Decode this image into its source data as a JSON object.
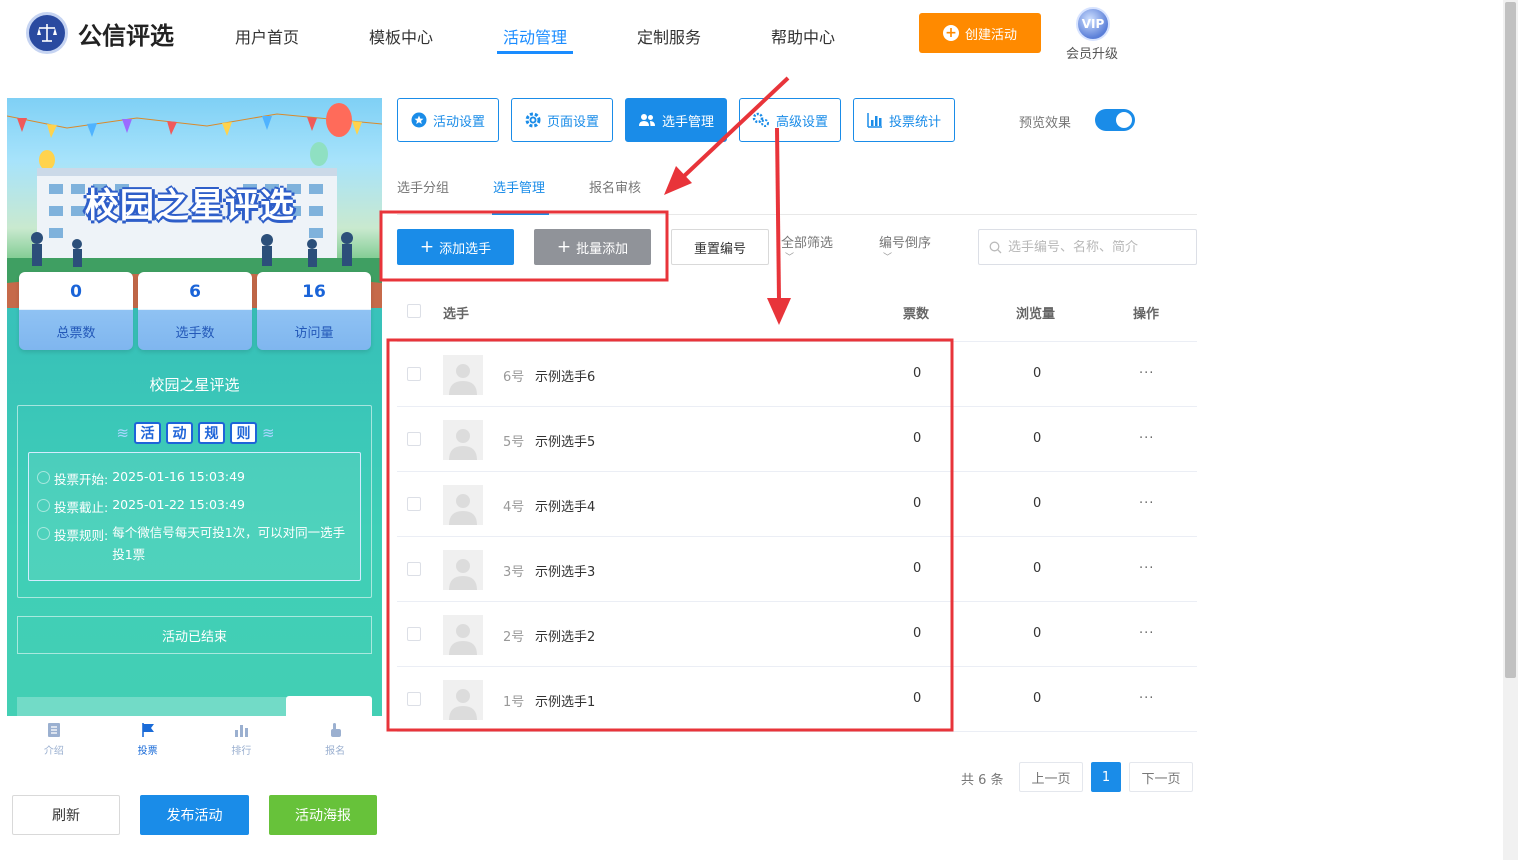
{
  "header": {
    "logo_text": "公信评选",
    "nav": [
      "用户首页",
      "模板中心",
      "活动管理",
      "定制服务",
      "帮助中心"
    ],
    "active_nav": "活动管理",
    "create_label": "创建活动",
    "vip_badge": "VIP",
    "vip_label": "会员升级"
  },
  "preview": {
    "banner_title": "校园之星评选",
    "stats": [
      {
        "value": "0",
        "label": "总票数"
      },
      {
        "value": "6",
        "label": "选手数"
      },
      {
        "value": "16",
        "label": "访问量"
      }
    ],
    "title": "校园之星评选",
    "rules_chars": [
      "活",
      "动",
      "规",
      "则"
    ],
    "rules": [
      {
        "label": "投票开始:",
        "text": "2025-01-16 15:03:49"
      },
      {
        "label": "投票截止:",
        "text": "2025-01-22 15:03:49"
      },
      {
        "label": "投票规则:",
        "text": "每个微信号每天可投1次，可以对同一选手投1票"
      }
    ],
    "ended": "活动已结束",
    "tabs": [
      {
        "label": "介绍",
        "icon": "document-icon"
      },
      {
        "label": "投票",
        "icon": "flag-icon"
      },
      {
        "label": "排行",
        "icon": "bar-chart-icon"
      },
      {
        "label": "报名",
        "icon": "hand-pointer-icon"
      }
    ],
    "active_tab": "投票"
  },
  "actions": {
    "refresh": "刷新",
    "publish": "发布活动",
    "poster": "活动海报"
  },
  "toolbar": {
    "buttons": [
      {
        "label": "活动设置",
        "icon": "star-icon"
      },
      {
        "label": "页面设置",
        "icon": "gear-icon"
      },
      {
        "label": "选手管理",
        "icon": "users-icon"
      },
      {
        "label": "高级设置",
        "icon": "gears-icon"
      },
      {
        "label": "投票统计",
        "icon": "bar-chart-icon"
      }
    ],
    "active": "选手管理",
    "preview_label": "预览效果",
    "preview_on": true
  },
  "subtabs": [
    "选手分组",
    "选手管理",
    "报名审核"
  ],
  "active_subtab": "选手管理",
  "list_actions": {
    "add": "添加选手",
    "batch": "批量添加",
    "renumber": "重置编号",
    "filter": "全部筛选",
    "sort": "编号倒序",
    "search_placeholder": "选手编号、名称、简介"
  },
  "table": {
    "headers": {
      "player": "选手",
      "votes": "票数",
      "views": "浏览量",
      "ops": "操作"
    },
    "rows": [
      {
        "num": "6号",
        "name": "示例选手6",
        "votes": "0",
        "views": "0"
      },
      {
        "num": "5号",
        "name": "示例选手5",
        "votes": "0",
        "views": "0"
      },
      {
        "num": "4号",
        "name": "示例选手4",
        "votes": "0",
        "views": "0"
      },
      {
        "num": "3号",
        "name": "示例选手3",
        "votes": "0",
        "views": "0"
      },
      {
        "num": "2号",
        "name": "示例选手2",
        "votes": "0",
        "views": "0"
      },
      {
        "num": "1号",
        "name": "示例选手1",
        "votes": "0",
        "views": "0"
      }
    ],
    "more": "···"
  },
  "pager": {
    "total": "共 6 条",
    "prev": "上一页",
    "current": "1",
    "next": "下一页"
  },
  "colors": {
    "primary": "#1a8ce8",
    "orange": "#ff8a00",
    "green": "#67c23a",
    "annotation": "#e8343a"
  }
}
